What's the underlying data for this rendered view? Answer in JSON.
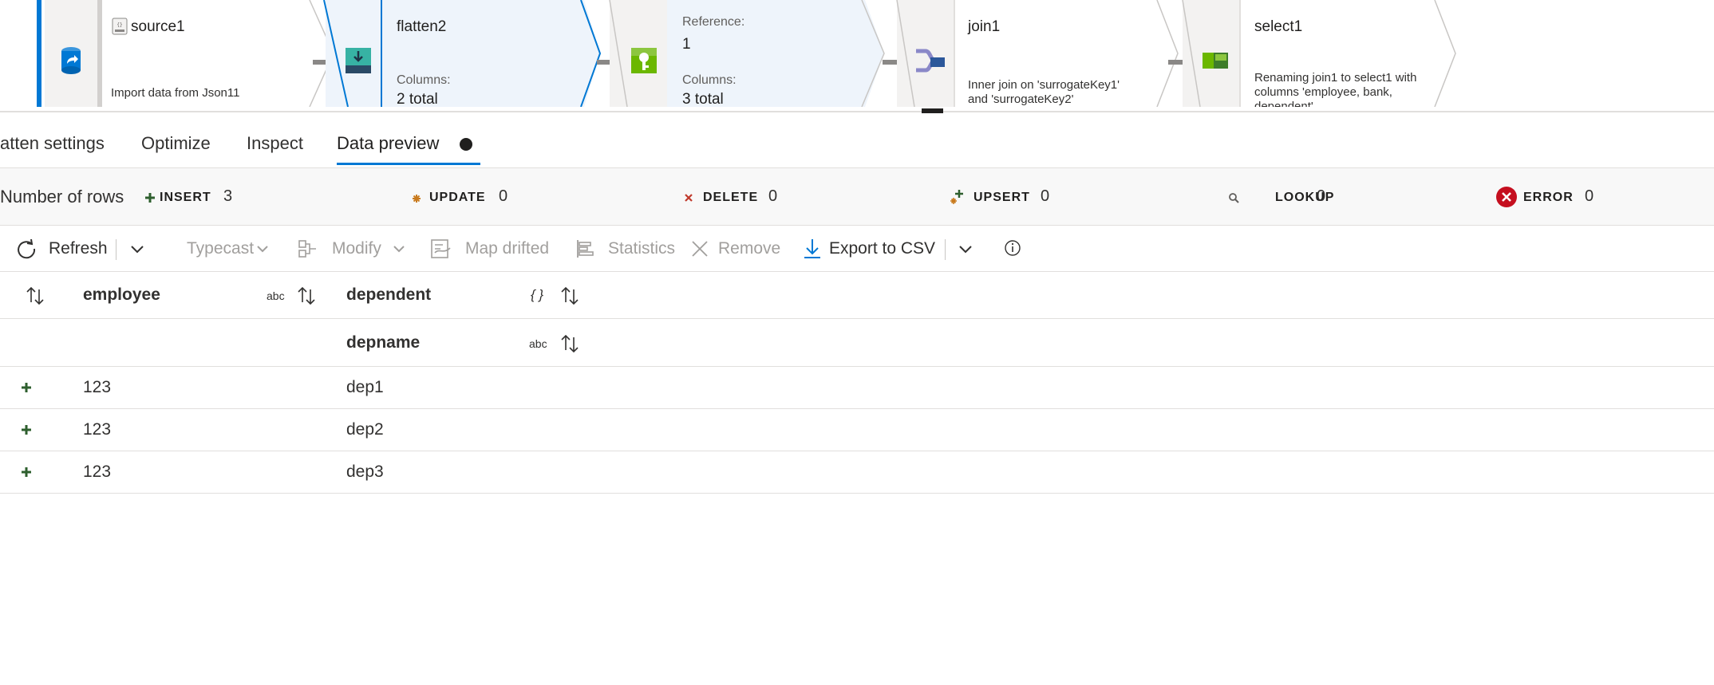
{
  "pipeline": {
    "nodes": [
      {
        "name": "source1",
        "description": "Import data from Json11",
        "icon": "source-icon"
      },
      {
        "name": "flatten2",
        "columns_label": "Columns:",
        "columns_value": "2 total",
        "icon": "flatten-icon"
      },
      {
        "name": "",
        "reference_label": "Reference:",
        "reference_value": "1",
        "columns_label": "Columns:",
        "columns_value": "3 total",
        "icon": "surrogate-key-icon"
      },
      {
        "name": "join1",
        "description_line1": "Inner join on 'surrogateKey1'",
        "description_line2": "and 'surrogateKey2'",
        "icon": "join-icon"
      },
      {
        "name": "select1",
        "description_line1": "Renaming join1 to select1 with",
        "description_line2": "columns 'employee, bank,",
        "description_line3": "dependent'",
        "icon": "select-icon"
      }
    ]
  },
  "tabs": [
    {
      "label": "atten settings"
    },
    {
      "label": "Optimize"
    },
    {
      "label": "Inspect"
    },
    {
      "label": "Data preview",
      "active": true
    }
  ],
  "row_counts": {
    "label": "Number of rows",
    "items": [
      {
        "name": "INSERT",
        "value": "3",
        "icon": "insert-plus-icon",
        "color": "#2e5f2e"
      },
      {
        "name": "UPDATE",
        "value": "0",
        "icon": "update-star-icon",
        "color": "#c97b1e"
      },
      {
        "name": "DELETE",
        "value": "0",
        "icon": "delete-x-icon",
        "color": "#c0392b"
      },
      {
        "name": "UPSERT",
        "value": "0",
        "icon": "upsert-icon",
        "color": "#2e5f2e"
      },
      {
        "name": "LOOKUP",
        "value": "0",
        "icon": "lookup-search-icon",
        "color": "#605e5c"
      },
      {
        "name": "ERROR",
        "value": "0",
        "icon": "error-circle-icon",
        "color": "#c50f1f"
      }
    ]
  },
  "toolbar": {
    "refresh": "Refresh",
    "typecast": "Typecast",
    "modify": "Modify",
    "map_drifted": "Map drifted",
    "statistics": "Statistics",
    "remove": "Remove",
    "export_csv": "Export to CSV"
  },
  "grid": {
    "columns": [
      {
        "name": "employee",
        "type": "abc"
      },
      {
        "name": "dependent",
        "type": "{ }"
      }
    ],
    "sub_columns": [
      {
        "name": "depname",
        "type": "abc"
      }
    ],
    "rows": [
      {
        "employee": "123",
        "depname": "dep1"
      },
      {
        "employee": "123",
        "depname": "dep2"
      },
      {
        "employee": "123",
        "depname": "dep3"
      }
    ]
  },
  "colors": {
    "accent": "#0078d4",
    "node_selected_fill": "#eef4fb",
    "insert_green": "#2e5f2e"
  }
}
